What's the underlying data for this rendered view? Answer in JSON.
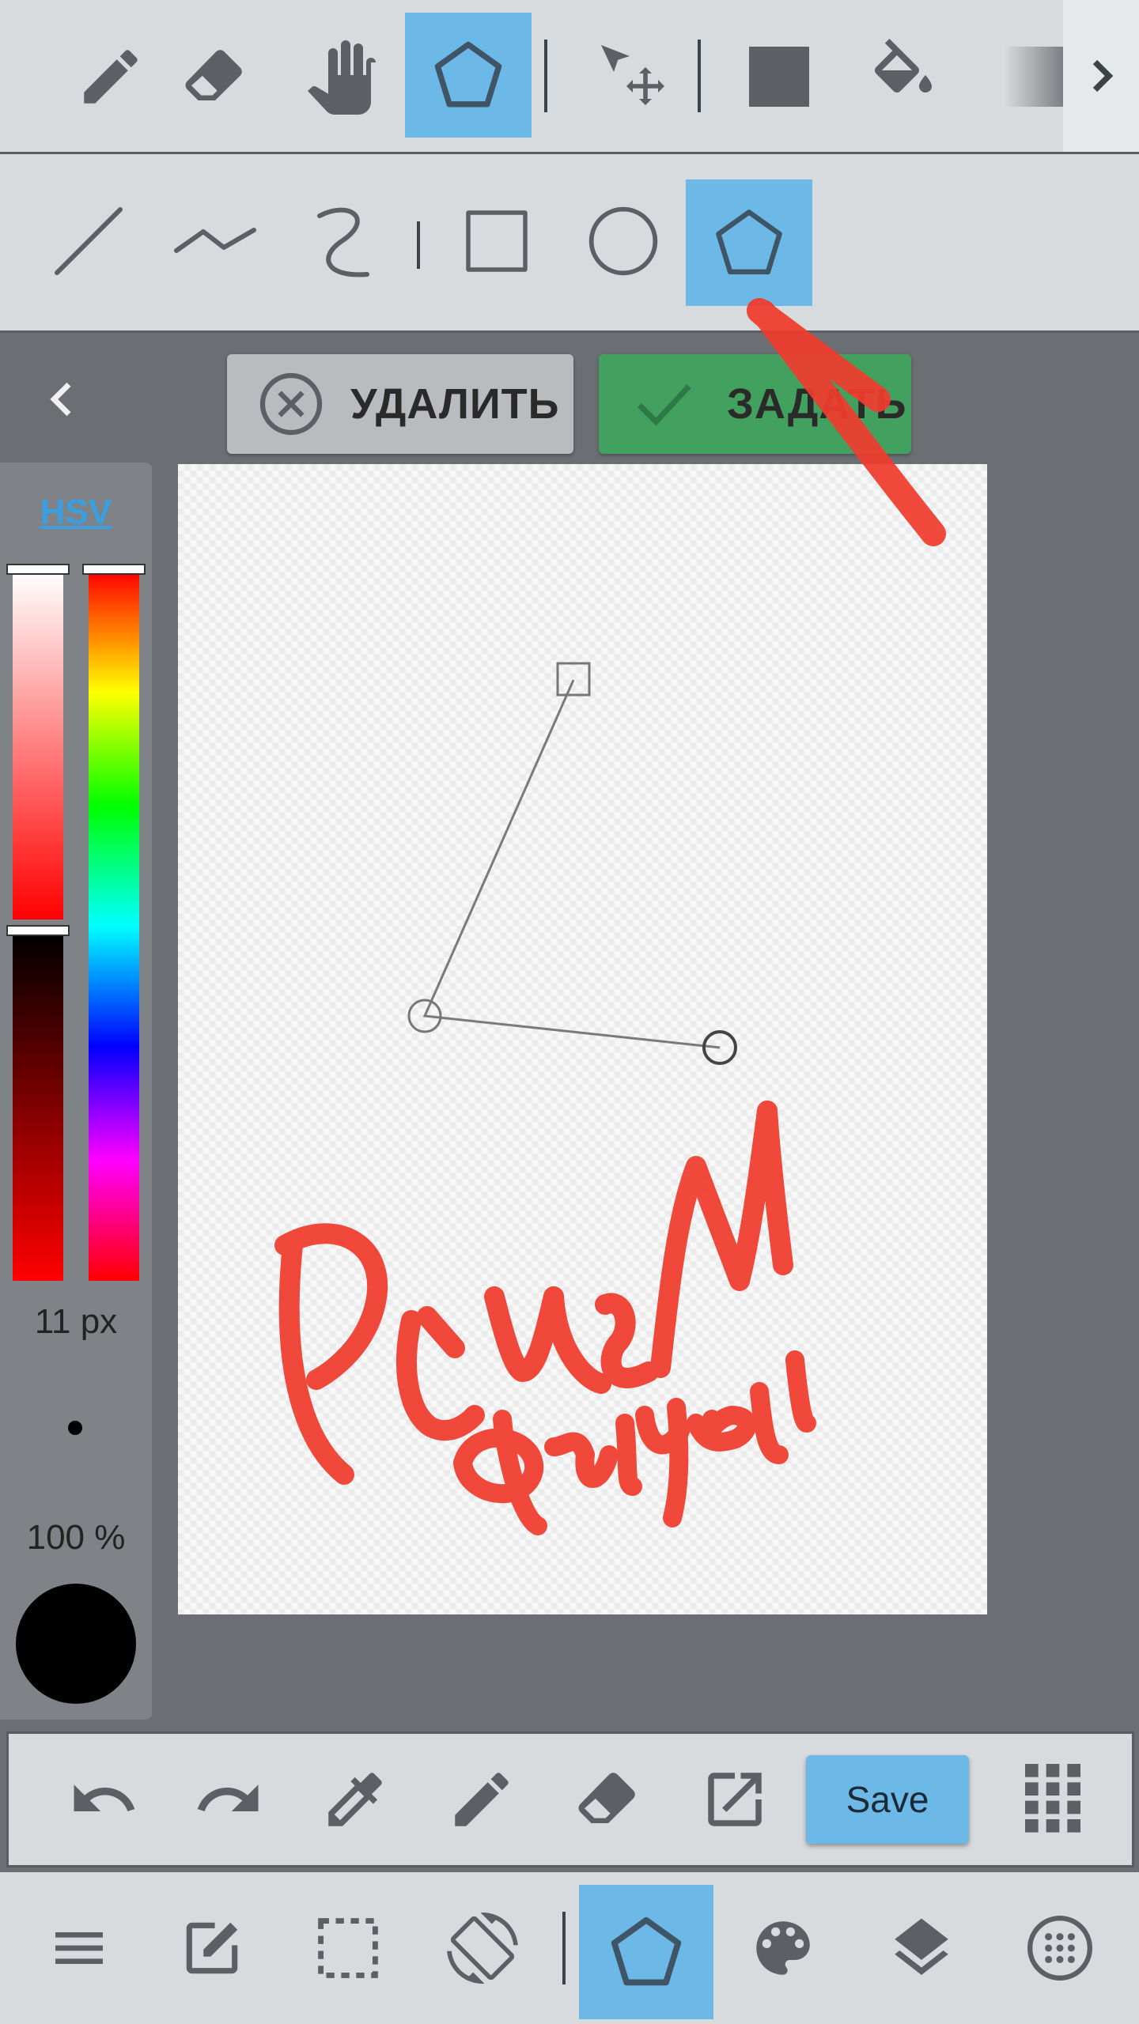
{
  "actions": {
    "delete_label": "УДАЛИТЬ",
    "confirm_label": "ЗАДАТЬ"
  },
  "color_panel": {
    "mode_label": "HSV",
    "brush_size": "11 px",
    "opacity": "100 %",
    "current_color": "#000000"
  },
  "bottom_toolbar": {
    "save_label": "Save"
  },
  "annotation": {
    "handwriting": "Рисуем фигуры",
    "color": "#f03c2e"
  },
  "colors": {
    "active_tool": "#6cb9e8",
    "confirm_button": "#43a160",
    "toolbar_bg": "#d7dbdd"
  }
}
